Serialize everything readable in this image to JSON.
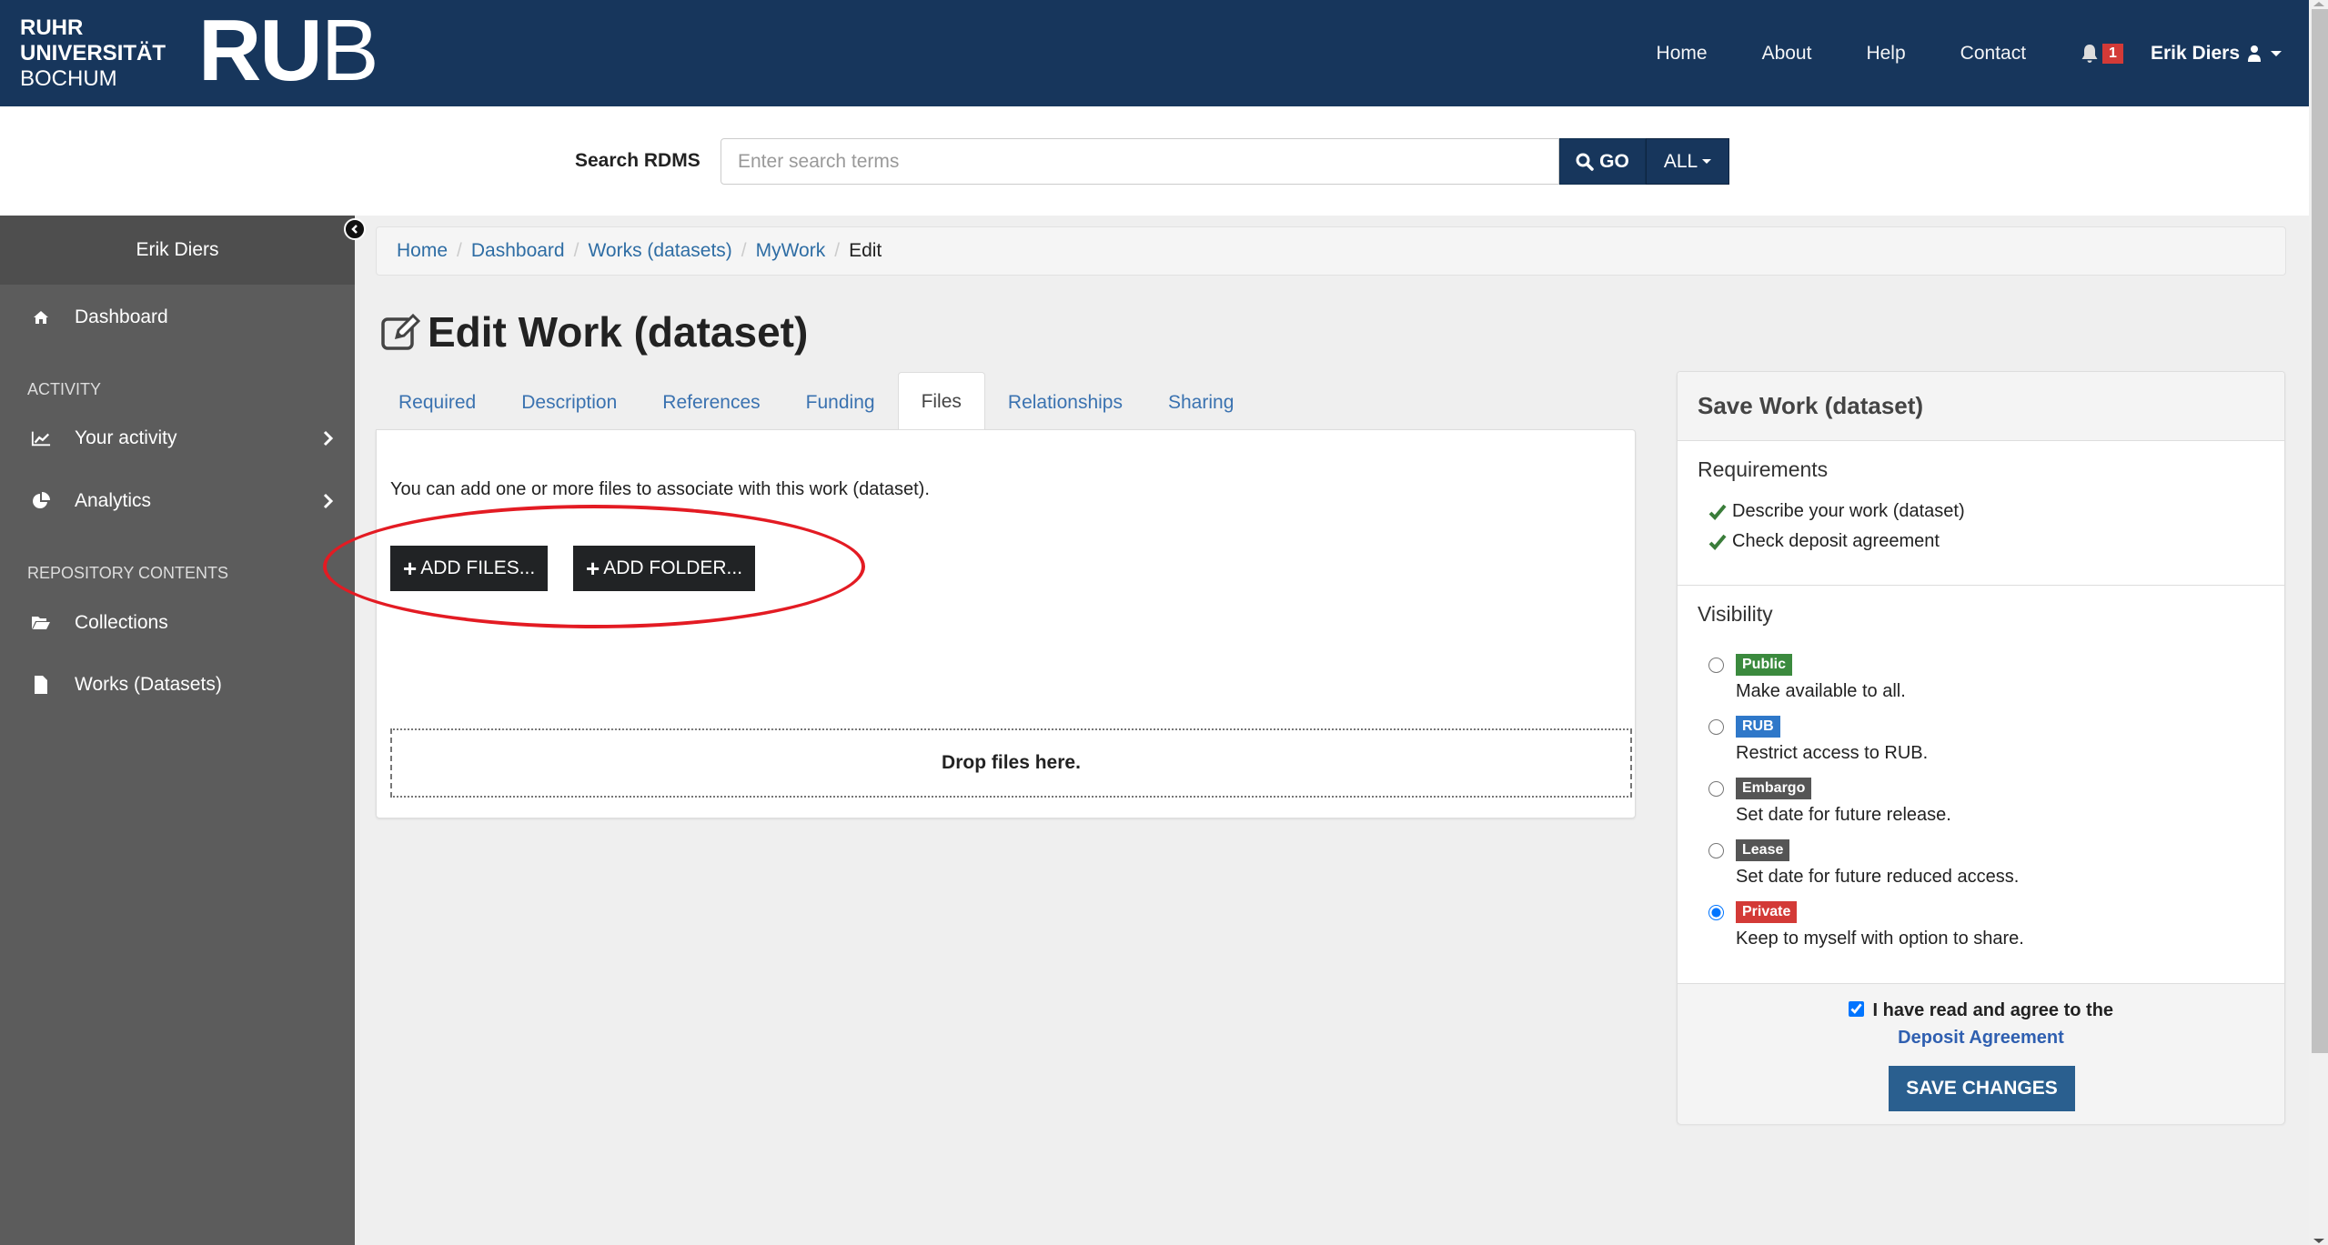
{
  "brand": {
    "line1": "RUHR",
    "line2": "UNIVERSITÄT",
    "line3": "BOCHUM",
    "mark_bold": "RU",
    "mark_light": "B"
  },
  "navbar": {
    "links": [
      "Home",
      "About",
      "Help",
      "Contact"
    ],
    "notification_count": "1",
    "user_name": "Erik Diers",
    "bg_color": "#17365c"
  },
  "search": {
    "label": "Search RDMS",
    "placeholder": "Enter search terms",
    "value": "",
    "go_label": "GO",
    "scope_label": "ALL"
  },
  "sidebar": {
    "user_name": "Erik Diers",
    "items": [
      {
        "label": "Dashboard",
        "icon": "home-icon"
      },
      {
        "label": "Your activity",
        "icon": "line-chart-icon",
        "has_submenu": true
      },
      {
        "label": "Analytics",
        "icon": "pie-chart-icon",
        "has_submenu": true
      },
      {
        "label": "Collections",
        "icon": "folder-open-icon"
      },
      {
        "label": "Works (Datasets)",
        "icon": "file-icon"
      }
    ],
    "sections": [
      "ACTIVITY",
      "REPOSITORY CONTENTS"
    ]
  },
  "breadcrumb": {
    "items": [
      "Home",
      "Dashboard",
      "Works (datasets)",
      "MyWork"
    ],
    "active": "Edit"
  },
  "page": {
    "title": "Edit Work (dataset)"
  },
  "tabs": {
    "items": [
      "Required",
      "Description",
      "References",
      "Funding",
      "Files",
      "Relationships",
      "Sharing"
    ],
    "active": "Files"
  },
  "files_panel": {
    "help_text": "You can add one or more files to associate with this work (dataset).",
    "add_files_label": "ADD FILES...",
    "add_folder_label": "ADD FOLDER...",
    "dropzone_text": "Drop files here."
  },
  "save_panel": {
    "title": "Save Work (dataset)",
    "requirements_title": "Requirements",
    "requirements": [
      "Describe your work (dataset)",
      "Check deposit agreement"
    ],
    "visibility_title": "Visibility",
    "visibility_options": [
      {
        "badge": "Public",
        "desc": "Make available to all.",
        "color": "#3b8a3e",
        "selected": false
      },
      {
        "badge": "RUB",
        "desc": "Restrict access to RUB.",
        "color": "#2f78c9",
        "selected": false
      },
      {
        "badge": "Embargo",
        "desc": "Set date for future release.",
        "color": "#555555",
        "selected": false
      },
      {
        "badge": "Lease",
        "desc": "Set date for future reduced access.",
        "color": "#555555",
        "selected": false
      },
      {
        "badge": "Private",
        "desc": "Keep to myself with option to share.",
        "color": "#d33a37",
        "selected": true
      }
    ],
    "agreement_text": "I have read and agree to the",
    "agreement_checked": true,
    "agreement_link": "Deposit Agreement",
    "save_label": "SAVE CHANGES"
  }
}
